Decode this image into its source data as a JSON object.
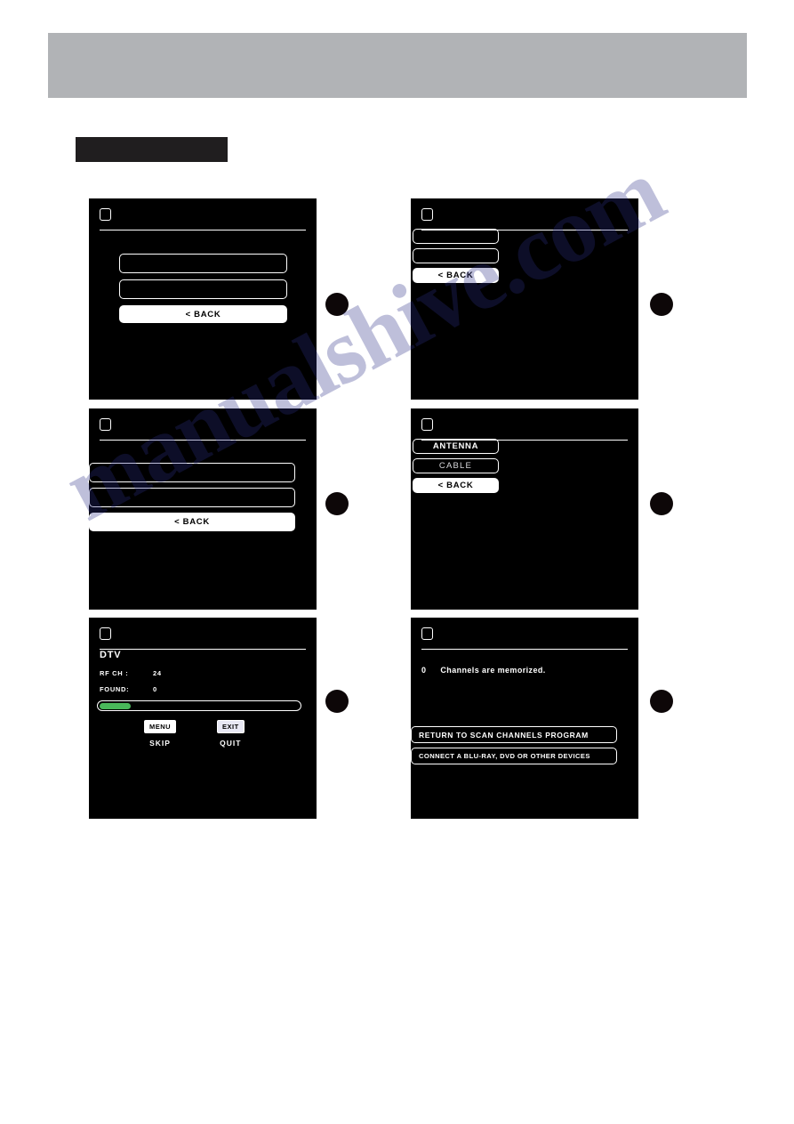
{
  "header": {
    "bar_color": "#b1b3b6",
    "title": ""
  },
  "section_tag": {
    "label": "",
    "color": "#201e1f"
  },
  "watermark": {
    "text": "manualshive.com"
  },
  "colors": {
    "screen_background": "#000000",
    "outline": "#ffffff",
    "progress_green": "#49b85a",
    "step_dot": "#0d0708"
  },
  "screens": [
    {
      "id": "screen-1",
      "header_title": "",
      "step_label": "",
      "buttons": [
        {
          "label": "",
          "style": "outline"
        },
        {
          "label": "",
          "style": "outline"
        },
        {
          "label": "< BACK",
          "style": "solid"
        }
      ]
    },
    {
      "id": "screen-2",
      "header_title": "",
      "step_label": "",
      "buttons": [
        {
          "label": "",
          "style": "outline"
        },
        {
          "label": "",
          "style": "outline"
        },
        {
          "label": "< BACK",
          "style": "solid"
        }
      ]
    },
    {
      "id": "screen-3",
      "header_title": "",
      "step_label": "",
      "buttons": [
        {
          "label": "",
          "style": "outline"
        },
        {
          "label": "",
          "style": "outline"
        },
        {
          "label": "< BACK",
          "style": "solid"
        }
      ]
    },
    {
      "id": "screen-4",
      "header_title": "",
      "step_label": "",
      "buttons": [
        {
          "label": "ANTENNA",
          "style": "outline"
        },
        {
          "label": "CABLE",
          "style": "dim"
        },
        {
          "label": "< BACK",
          "style": "solid"
        }
      ]
    },
    {
      "id": "screen-5",
      "header_title": "",
      "step_label": "",
      "mode_label": "DTV",
      "rows": [
        {
          "key": "RF CH :",
          "value": "24"
        },
        {
          "key": "FOUND:",
          "value": "0"
        }
      ],
      "progress_percent": 17,
      "keys": [
        {
          "cap": "MENU",
          "action": "SKIP"
        },
        {
          "cap": "EXIT",
          "action": "QUIT"
        }
      ]
    },
    {
      "id": "screen-6",
      "header_title": "",
      "step_label": "",
      "message_count": "0",
      "message_text": "Channels are memorized.",
      "buttons": [
        {
          "label": "RETURN TO SCAN CHANNELS PROGRAM",
          "style": "outline"
        },
        {
          "label": "CONNECT A BLU-RAY, DVD OR OTHER DEVICES",
          "style": "outline"
        }
      ]
    }
  ]
}
